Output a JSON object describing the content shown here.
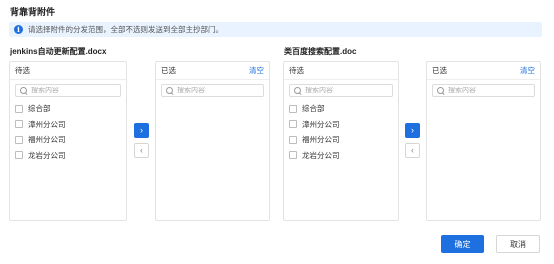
{
  "dialog": {
    "title": "背靠背附件"
  },
  "notice": {
    "text": "请选择附件的分发范围，全部不选则发送到全部主抄部门。"
  },
  "files": [
    {
      "name": "jenkins自动更新配置.docx",
      "left": {
        "title": "待选",
        "search_placeholder": "搜索内容",
        "options": [
          "综合部",
          "漳州分公司",
          "福州分公司",
          "龙岩分公司"
        ]
      },
      "right": {
        "title": "已选",
        "clear_label": "清空",
        "search_placeholder": "搜索内容"
      }
    },
    {
      "name": "类百度搜索配置.doc",
      "left": {
        "title": "待选",
        "search_placeholder": "搜索内容",
        "options": [
          "综合部",
          "漳州分公司",
          "福州分公司",
          "龙岩分公司"
        ]
      },
      "right": {
        "title": "已选",
        "clear_label": "清空",
        "search_placeholder": "搜索内容"
      }
    }
  ],
  "transfer": {
    "to_right_glyph": "›",
    "to_left_glyph": "‹"
  },
  "footer": {
    "ok_label": "确定",
    "cancel_label": "取消"
  },
  "colors": {
    "accent": "#1e6fe0",
    "notice_bg": "#e8f3ff"
  }
}
